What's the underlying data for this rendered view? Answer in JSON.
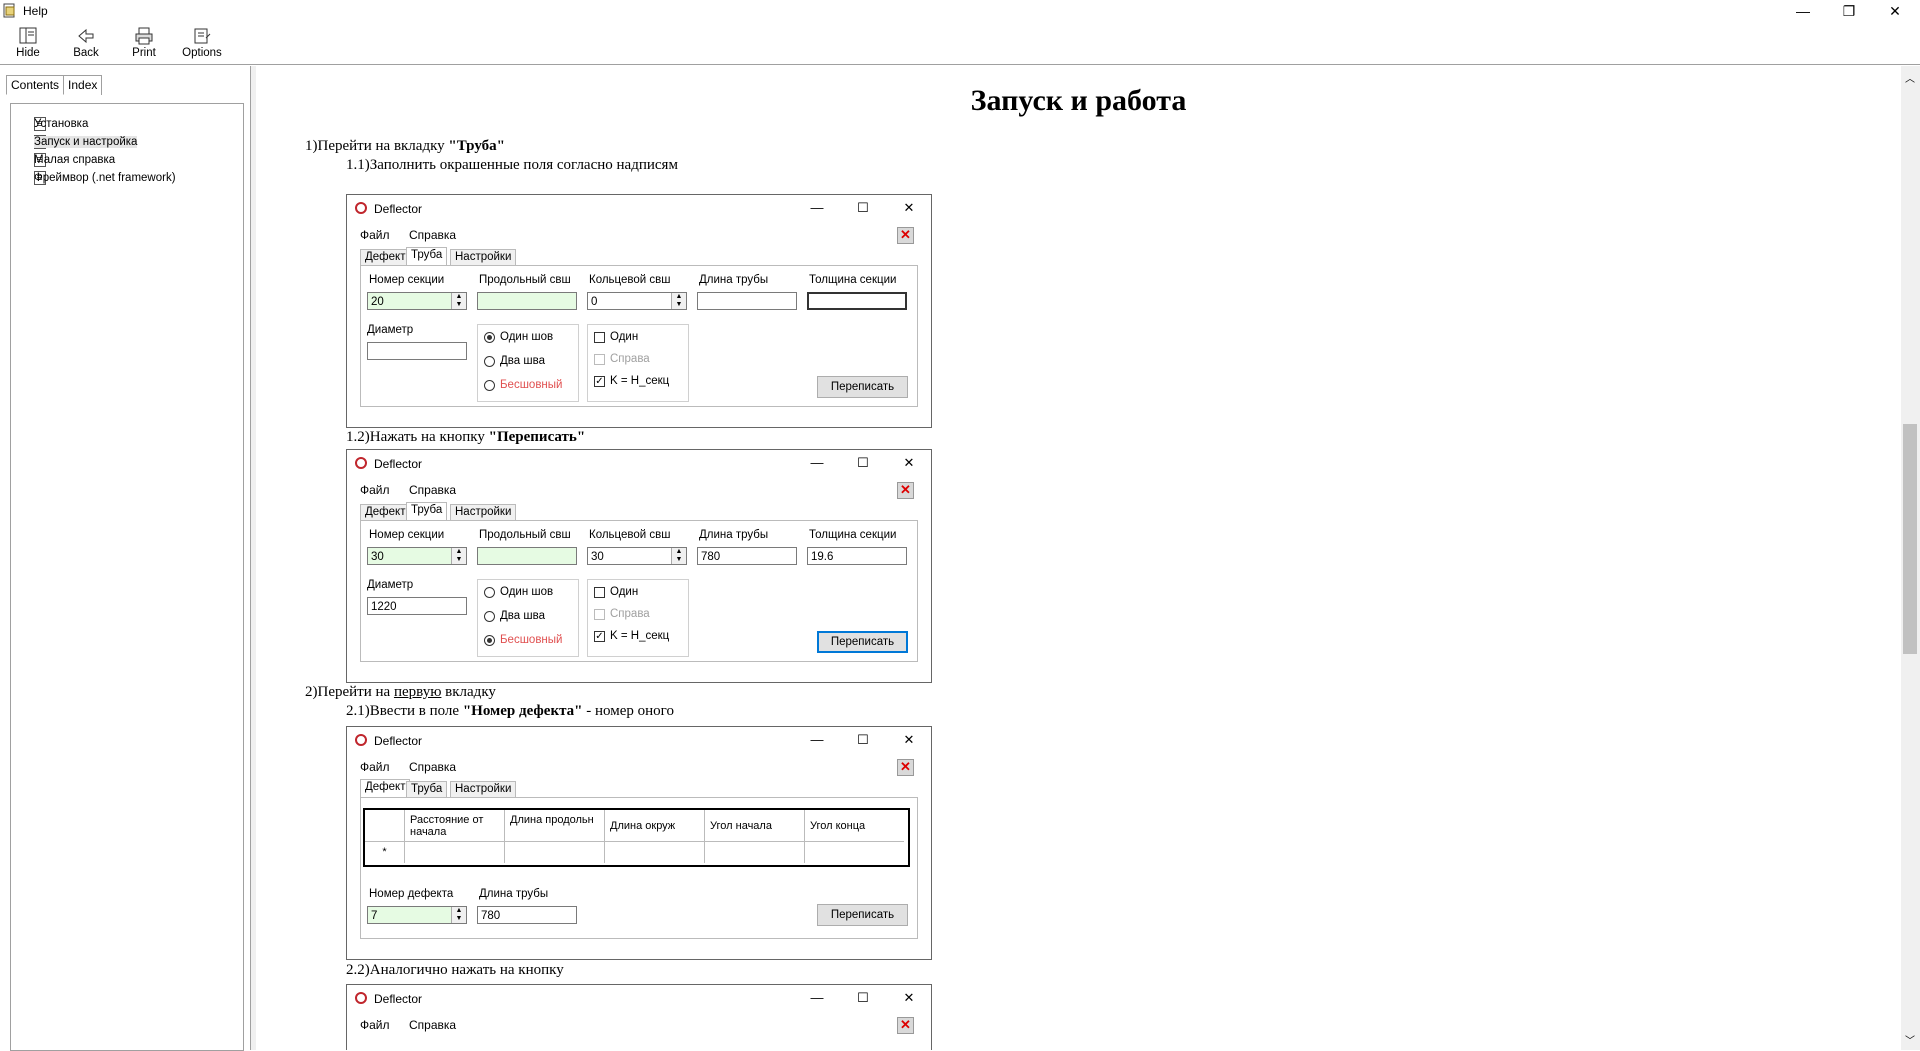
{
  "window": {
    "title": "Help",
    "minimize": "—",
    "restore": "❐",
    "close": "✕"
  },
  "toolbar": {
    "hide": "Hide",
    "back": "Back",
    "print": "Print",
    "options": "Options"
  },
  "nav": {
    "tab_contents": "Contents",
    "tab_index": "Index",
    "items": [
      "Установка",
      "Запуск и настройка",
      "Малая справка",
      "Фреймвор (.net framework)"
    ]
  },
  "content": {
    "heading": "Запуск и работа",
    "step1_pre": "1)Перейти на вкладку ",
    "step1_bold": "\"Труба\"",
    "step1_1": "1.1)Заполнить окрашенные поля согласно надписям",
    "step1_2_pre": "1.2)Нажать на кнопку ",
    "step1_2_bold": "\"Переписать\"",
    "step2_pre": "2)Перейти на ",
    "step2_u": "первую",
    "step2_post": " вкладку",
    "step2_1_pre": "2.1)Ввести в поле ",
    "step2_1_bold": "\"Номер дефекта\"",
    "step2_1_post": " - номер оного",
    "step2_2": "2.2)Аналогично нажать на кнопку"
  },
  "app": {
    "title": "Deflector",
    "menu_file": "Файл",
    "menu_help": "Справка",
    "tab_defect": "Дефект",
    "tab_pipe": "Труба",
    "tab_settings": "Настройки",
    "lbl_section": "Номер секции",
    "lbl_long_seam": "Продольный свш",
    "lbl_ring_seam": "Кольцевой свш",
    "lbl_pipe_len": "Длина трубы",
    "lbl_thickness": "Толщина секции",
    "lbl_diameter": "Диаметр",
    "radio_one": "Один шов",
    "radio_two": "Два шва",
    "radio_seamless": "Бесшовный",
    "chk_one": "Один",
    "chk_right": "Справа",
    "chk_k": "K = H_секц",
    "btn_rewrite": "Переписать",
    "lbl_defect_no": "Номер дефекта",
    "col_dist": "Расстояние от начала",
    "col_len": "Длина продольн",
    "col_circ": "Длина окруж",
    "col_start": "Угол начала",
    "col_end": "Угол конца",
    "row_marker": "*"
  },
  "shot1": {
    "section": "20",
    "long_seam": "",
    "ring_seam": "0",
    "pipe_len": "",
    "thickness": "",
    "diameter": ""
  },
  "shot2": {
    "section": "30",
    "long_seam": "",
    "ring_seam": "30",
    "pipe_len": "780",
    "thickness": "19.6",
    "diameter": "1220"
  },
  "shot3": {
    "defect_no": "7",
    "pipe_len": "780"
  },
  "colors": {
    "accent_red": "#e05050",
    "field_green": "#e6fbe3",
    "focus_blue": "#0078d7"
  }
}
